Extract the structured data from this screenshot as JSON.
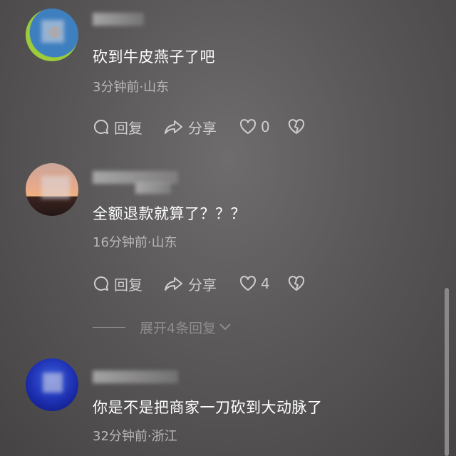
{
  "comments": [
    {
      "text": "砍到牛皮燕子了吧",
      "meta": "3分钟前·山东",
      "reply_label": "回复",
      "share_label": "分享",
      "like_count": "0"
    },
    {
      "text": "全额退款就算了？？？",
      "meta": "16分钟前·山东",
      "reply_label": "回复",
      "share_label": "分享",
      "like_count": "4",
      "expand_label": "展开4条回复"
    },
    {
      "text": "你是不是把商家一刀砍到大动脉了",
      "meta": "32分钟前·浙江"
    }
  ],
  "icons": [
    "comment-icon",
    "share-icon",
    "heart-icon",
    "broken-heart-icon",
    "chevron-down-icon"
  ],
  "colors": {
    "background": "#5a5858",
    "meta_text": "#b9b7b7",
    "action_text": "#cfcdcd"
  }
}
